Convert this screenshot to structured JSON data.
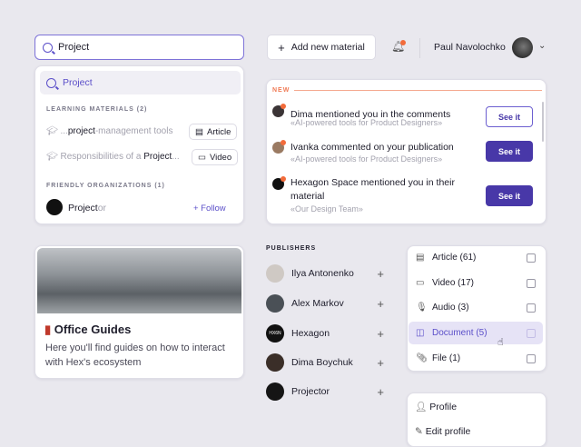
{
  "search": {
    "value": "Project",
    "suggestion": "Project",
    "materials_header": "LEARNING MATERIALS (2)",
    "materials": [
      {
        "prefix": "...",
        "match": "project",
        "suffix": "-management tools",
        "type": "Article"
      },
      {
        "prefix": "Responsibilities of a ",
        "match": "Project",
        "suffix": "...",
        "type": "Video"
      }
    ],
    "orgs_header": "FRIENDLY ORGANIZATIONS (1)",
    "org": {
      "match": "Project",
      "suffix": "or",
      "follow": "+ Follow"
    }
  },
  "guide": {
    "title": "Office Guides",
    "description": "Here you'll find guides on how to interact with Hex's ecosystem"
  },
  "header": {
    "add_button": "Add new material",
    "user_name": "Paul Navolochko"
  },
  "notifications": {
    "label": "NEW",
    "items": [
      {
        "title": "Dima mentioned you in the comments",
        "subtitle": "«AI-powered tools for Product Designers»",
        "button": "See it"
      },
      {
        "title": "Ivanka commented on your publication",
        "subtitle": "«AI-powered tools for Product Designers»",
        "button": "See it"
      },
      {
        "title": "Hexagon Space mentioned you in their material",
        "subtitle": "«Our Design Team»",
        "button": "See it"
      }
    ]
  },
  "publishers": {
    "label": "PUBLISHERS",
    "items": [
      {
        "name": "Ilya Antonenko"
      },
      {
        "name": "Alex Markov"
      },
      {
        "name": "Hexagon",
        "logo": "HX6N"
      },
      {
        "name": "Dima Boychuk"
      },
      {
        "name": "Projector"
      }
    ]
  },
  "filters": [
    {
      "label": "Article (61)",
      "icon": "article-icon"
    },
    {
      "label": "Video (17)",
      "icon": "video-icon"
    },
    {
      "label": "Audio (3)",
      "icon": "mic-icon"
    },
    {
      "label": "Document (5)",
      "icon": "document-icon"
    },
    {
      "label": "File (1)",
      "icon": "paperclip-icon"
    }
  ],
  "profile_menu": {
    "items": [
      "Profile",
      "Edit profile"
    ]
  },
  "colors": {
    "accent": "#4838a8",
    "notification": "#f26b3a"
  }
}
